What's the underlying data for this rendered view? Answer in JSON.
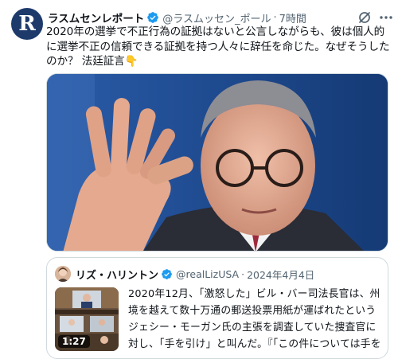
{
  "tweet": {
    "avatar_letter": "R",
    "display_name": "ラスムセンレポート",
    "handle": "@ラスムッセン_ポール",
    "separator": "·",
    "time": "7時間",
    "text": "2020年の選挙で不正行為の証拠はないと公言しながらも、彼は個人的に選挙不正の信頼できる証拠を持つ人々に辞任を命じた。なぜそうしたのか？ 法廷証言👇",
    "icons": {
      "verified": "verified-badge-icon",
      "grok": "grok-icon",
      "more": "more-icon"
    }
  },
  "quote": {
    "display_name": "リズ・ハリントン",
    "handle": "@realLizUSA",
    "separator": "·",
    "date": "2024年4月4日",
    "duration": "1:27",
    "text": "2020年12月、「激怒した」ビル・バー司法長官は、州境を越えて数十万通の郵送投票用紙が運ばれたというジェシー・モーガン氏の主張を調査していた捜査官に対し、「手を引け」と叫んだ。『「この件については手を引けと言っただろう』」「控えめに言っても、彼は動揺してい…"
  },
  "colors": {
    "accent": "#1d9bf0",
    "text": "#0f1419",
    "muted": "#536471",
    "border": "#cfd9de"
  }
}
